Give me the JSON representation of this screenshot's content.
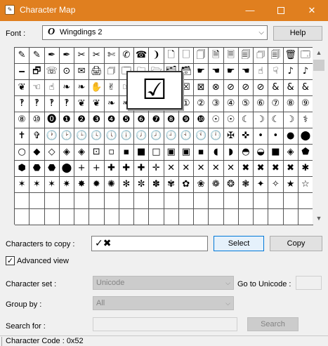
{
  "window": {
    "title": "Character Map",
    "icons": {
      "app": "charmap-app-icon",
      "minimize": "minimize-icon",
      "maximize": "maximize-icon",
      "close": "close-icon"
    }
  },
  "font": {
    "label": "Font :",
    "value": "Wingdings 2",
    "icon": "opentype-font-icon",
    "help_label": "Help"
  },
  "grid": {
    "columns": 20,
    "rows": [
      [
        "✎",
        "✎",
        "✒",
        "✒",
        "✂",
        "✂",
        "✄",
        "✆",
        "☎",
        "❩",
        "🗋",
        "🗌",
        "🗍",
        "🗎",
        "🗏",
        "🗐",
        "🗇",
        "🗐",
        "🗑",
        "🗔"
      ],
      [
        "🗕",
        "🗗",
        "☏",
        "⊙",
        "✉",
        "🖨",
        "🗇",
        "🗔",
        "🗀",
        "🗁",
        "🗂",
        "🗃",
        "☛",
        "☚",
        "☛",
        "☚",
        "☝",
        "☟",
        "♪",
        "♪"
      ],
      [
        "❦",
        "☜",
        "☝",
        "❧",
        "❧",
        "✋",
        "✌",
        "☞",
        "✍",
        "✓",
        "☑",
        "☒",
        "⊠",
        "⊗",
        "⊘",
        "⊘",
        "⊘",
        "&",
        "&",
        "&"
      ],
      [
        "‽",
        "‽",
        "‽",
        "‽",
        "❦",
        "❦",
        "❧",
        "❧",
        "❦",
        "❦",
        "⓪",
        "①",
        "②",
        "③",
        "④",
        "⑤",
        "⑥",
        "⑦",
        "⑧",
        "⑨"
      ],
      [
        "⑧",
        "⑩",
        "⓿",
        "❶",
        "❷",
        "❸",
        "❹",
        "❺",
        "❻",
        "❼",
        "❽",
        "❾",
        "❿",
        "☉",
        "☉",
        "☾",
        "☽",
        "☾",
        "☽",
        "⚕"
      ],
      [
        "✝",
        "✞",
        "🕐",
        "🕑",
        "🕒",
        "🕓",
        "🕔",
        "🕕",
        "🕖",
        "🕗",
        "🕘",
        "🕙",
        "🕚",
        "🕛",
        "✠",
        "✜",
        "•",
        "•",
        "●",
        "⬤"
      ],
      [
        "○",
        "◆",
        "◇",
        "◈",
        "◈",
        "⊡",
        "▫",
        "▪",
        "■",
        "□",
        "▣",
        "▣",
        "▪",
        "◖",
        "◗",
        "◓",
        "◒",
        "■",
        "◈",
        "⬟"
      ],
      [
        "⬢",
        "⬣",
        "⬣",
        "⬤",
        "+",
        "+",
        "✚",
        "✚",
        "✚",
        "✛",
        "✕",
        "✕",
        "✕",
        "✕",
        "✕",
        "✖",
        "✖",
        "✖",
        "✖",
        "✱"
      ],
      [
        "✶",
        "✶",
        "✶",
        "✷",
        "✸",
        "✹",
        "✺",
        "✻",
        "✼",
        "✽",
        "✾",
        "✿",
        "❀",
        "❁",
        "❂",
        "❃",
        "✦",
        "✧",
        "★",
        "☆"
      ],
      [
        "",
        "",
        "",
        "",
        "",
        "",
        "",
        "",
        "",
        "",
        "",
        "",
        "",
        "",
        "",
        "",
        "",
        "",
        "",
        ""
      ],
      [
        "",
        "",
        "",
        "",
        "",
        "",
        "",
        "",
        "",
        "",
        "",
        "",
        "",
        "",
        "",
        "",
        "",
        "",
        "",
        ""
      ]
    ],
    "magnified_char": "☑"
  },
  "copy": {
    "label": "Characters to copy :",
    "value": "✓✖",
    "select_label": "Select",
    "copy_label": "Copy"
  },
  "advanced": {
    "label": "Advanced view",
    "checked": true
  },
  "charset": {
    "label": "Character set :",
    "value": "Unicode"
  },
  "goto": {
    "label": "Go to Unicode :"
  },
  "groupby": {
    "label": "Group by :",
    "value": "All"
  },
  "search": {
    "label": "Search for :",
    "button_label": "Search"
  },
  "status": {
    "text": "Character Code : 0x52"
  }
}
